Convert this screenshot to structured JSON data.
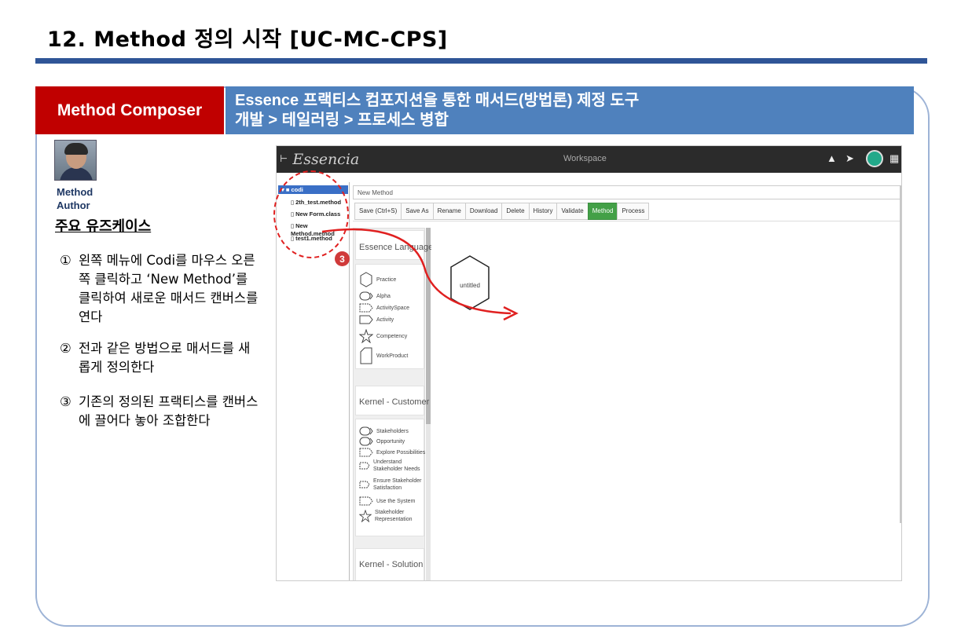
{
  "slide": {
    "title": "12. Method 정의 시작 [UC-MC-CPS]"
  },
  "band": {
    "left_label": "Method Composer",
    "right_line1": "Essence 프랙티스 컴포지션을 통한 매서드(방법론) 제정 도구",
    "right_line2": "개발 > 테일러링 > 프로세스 병합"
  },
  "author": {
    "line1": "Method",
    "line2": "Author"
  },
  "usecases": {
    "heading": "주요 유즈케이스",
    "steps": [
      {
        "num": "①",
        "text": "왼쪽 메뉴에 Codi를 마우스 오른쪽 클릭하고 ‘New Method’를 클릭하여 새로운 매서드 캔버스를 연다"
      },
      {
        "num": "②",
        "text": "전과 같은 방법으로 매서드를 새롭게 정의한다"
      },
      {
        "num": "③",
        "text": "기존의 정의된 프랙티스를 캔버스에 끌어다 놓아 조합한다"
      }
    ]
  },
  "app": {
    "logo": "Essencia",
    "workspace": "Workspace",
    "tree": {
      "root": "codi",
      "items": [
        "2th_test.method",
        "New Form.class",
        "New Method.method",
        "test1.method"
      ]
    },
    "name_field": "New Method",
    "toolbar": [
      "Save (Ctrl+S)",
      "Save As",
      "Rename",
      "Download",
      "Delete",
      "History",
      "Validate",
      "Method",
      "Process"
    ],
    "active_tab": "Method",
    "palette": {
      "essence_language": {
        "title": "Essence Language",
        "items": [
          "Practice",
          "Alpha",
          "ActivitySpace",
          "Activity",
          "Competency",
          "WorkProduct"
        ]
      },
      "kernel_customer": {
        "title": "Kernel - Customer",
        "items": [
          "Stakeholders",
          "Opportunity",
          "Explore Possibilities",
          "Understand Stakeholder Needs",
          "Ensure Stakeholder Satisfaction",
          "Use the System",
          "Stakeholder Representation"
        ]
      },
      "kernel_solution": {
        "title": "Kernel - Solution"
      }
    },
    "canvas_node": "untitled",
    "callout_badge": "3"
  },
  "colors": {
    "title_rule": "#2f5597",
    "band_left": "#c00000",
    "band_right": "#4f81bd",
    "active_button": "#43a047",
    "arrow": "#e02020"
  }
}
